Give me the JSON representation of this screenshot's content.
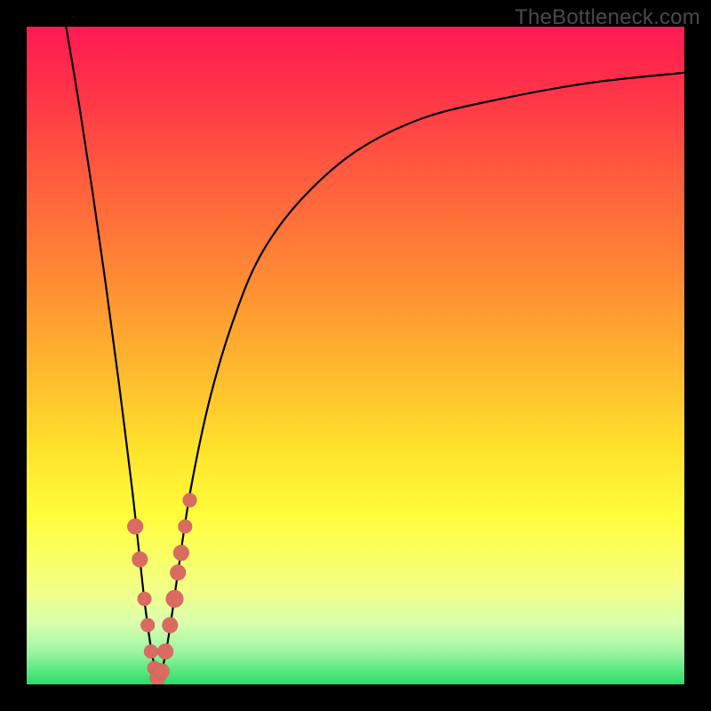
{
  "watermark": "TheBottleneck.com",
  "chart_data": {
    "type": "line",
    "title": "",
    "xlabel": "",
    "ylabel": "",
    "xlim": [
      0,
      100
    ],
    "ylim": [
      0,
      100
    ],
    "grid": false,
    "legend": false,
    "series": [
      {
        "name": "bottleneck-curve",
        "x": [
          6,
          8,
          10,
          12,
          14,
          16,
          17,
          18,
          19,
          20,
          21,
          22,
          23,
          25,
          28,
          32,
          36,
          42,
          50,
          60,
          72,
          86,
          100
        ],
        "y": [
          100,
          88,
          75,
          61,
          46,
          30,
          21,
          12,
          5,
          1,
          4,
          10,
          17,
          30,
          44,
          57,
          66,
          74,
          81,
          86,
          89,
          91.5,
          93
        ]
      }
    ],
    "markers": {
      "name": "highlight-points",
      "x": [
        16.5,
        17.2,
        17.9,
        18.4,
        18.9,
        19.4,
        19.9,
        20.5,
        21.1,
        21.8,
        22.5,
        23.0,
        23.5,
        24.1,
        24.8
      ],
      "y": [
        24,
        19,
        13,
        9,
        5,
        2.5,
        1,
        2,
        5,
        9,
        13,
        17,
        20,
        24,
        28
      ],
      "r": [
        9,
        9,
        8,
        8,
        8,
        8,
        9,
        9,
        9,
        9,
        10,
        9,
        9,
        8,
        8
      ]
    },
    "background_gradient": {
      "top": "#ff1a54",
      "mid": "#ffe22c",
      "bottom": "#2add6a"
    }
  }
}
